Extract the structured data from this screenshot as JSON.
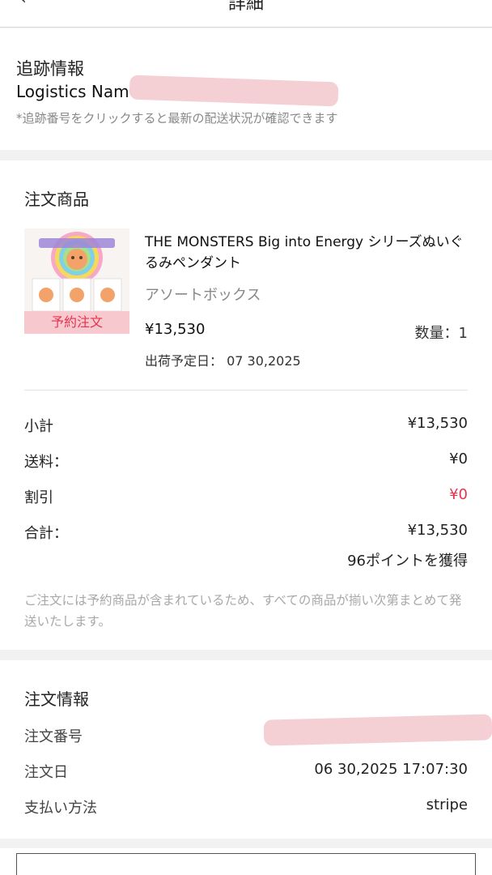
{
  "header": {
    "back_icon": "chevron-left-icon",
    "back_glyph": "‹",
    "title": "詳細"
  },
  "tracking": {
    "title": "追跡情報",
    "logistics_name": "Logistics Nam",
    "note": "*追跡番号をクリックすると最新の配送状況が確認できます"
  },
  "goods": {
    "title": "注文商品",
    "item": {
      "name": "THE MONSTERS Big into Energy シリーズぬいぐるみペンダント",
      "variant": "アソートボックス",
      "price": "¥13,530",
      "quantity": "数量：1",
      "badge": "予約注文",
      "ship_label": "出荷予定日：",
      "ship_date": "07 30,2025"
    },
    "summary": {
      "subtotal_label": "小計",
      "subtotal_value": "¥13,530",
      "shipping_label": "送料：",
      "shipping_value": "¥0",
      "discount_label": "割引",
      "discount_value": "¥0",
      "total_label": "合計：",
      "total_value": "¥13,530",
      "points": "96ポイントを獲得"
    },
    "preorder_note": "ご注文には予約商品が含まれているため、すべての商品が揃い次第まとめて発送いたします。"
  },
  "order_info": {
    "title": "注文情報",
    "order_number_label": "注文番号",
    "order_date_label": "注文日",
    "order_date_value": "06 30,2025 17:07:30",
    "payment_label": "支払い方法",
    "payment_value": "stripe"
  },
  "colors": {
    "accent_red": "#e6334f",
    "badge_bg": "#f7c9cf",
    "redaction": "#f3cdd3",
    "muted_text": "#888888",
    "page_bg": "#f2f2f2"
  }
}
